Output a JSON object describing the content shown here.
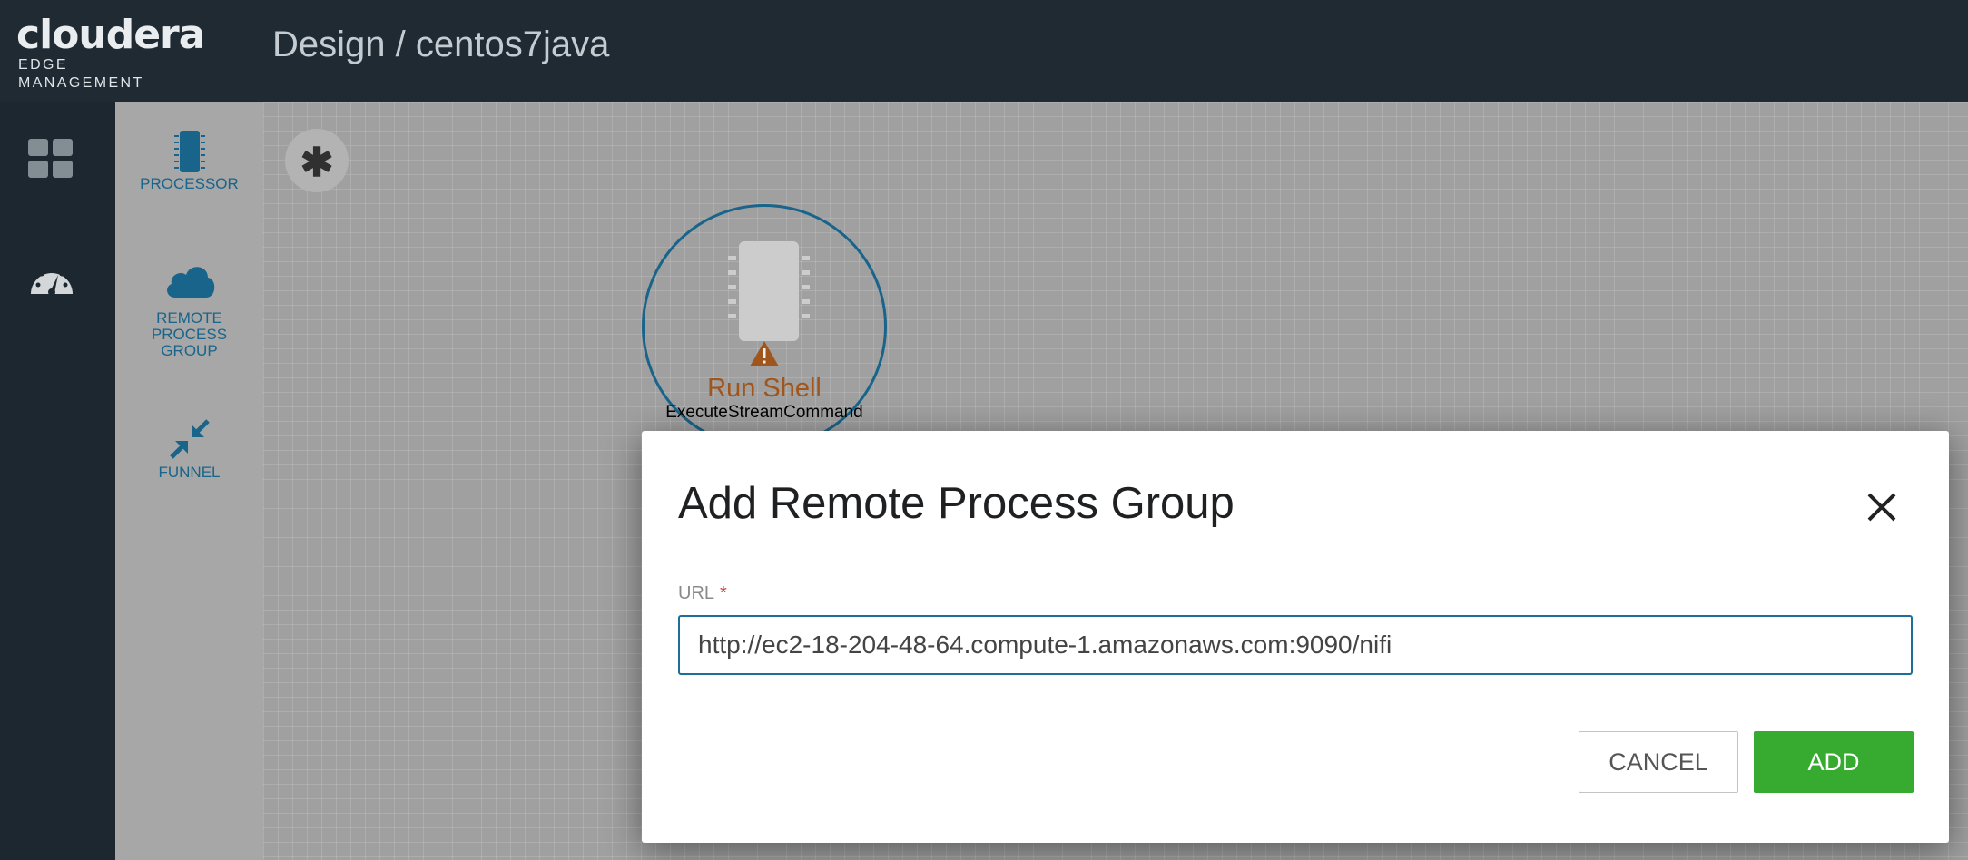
{
  "header": {
    "logo_main": "cloudera",
    "logo_sub": "EDGE MANAGEMENT",
    "breadcrumb": "Design / centos7java"
  },
  "rail": {
    "items": [
      {
        "icon": "dashboard-grid-icon"
      },
      {
        "icon": "gauge-icon"
      }
    ]
  },
  "palette": {
    "items": [
      {
        "label": "PROCESSOR",
        "icon": "processor-chip-icon"
      },
      {
        "label": "REMOTE PROCESS GROUP",
        "icon": "cloud-icon"
      },
      {
        "label": "FUNNEL",
        "icon": "funnel-arrows-icon"
      }
    ]
  },
  "canvas": {
    "fab_symbol": "✱",
    "processor": {
      "name": "Run Shell",
      "type": "ExecuteStreamCommand",
      "status": "warning"
    }
  },
  "dialog": {
    "title": "Add Remote Process Group",
    "url_label": "URL",
    "url_required": "*",
    "url_value": "http://ec2-18-204-48-64.compute-1.amazonaws.com:9090/nifi",
    "cancel_label": "CANCEL",
    "add_label": "ADD"
  },
  "colors": {
    "header_bg": "#1f2a33",
    "accent": "#1a6a92",
    "add_button": "#36ab2f",
    "processor_name": "#a95a1f"
  }
}
